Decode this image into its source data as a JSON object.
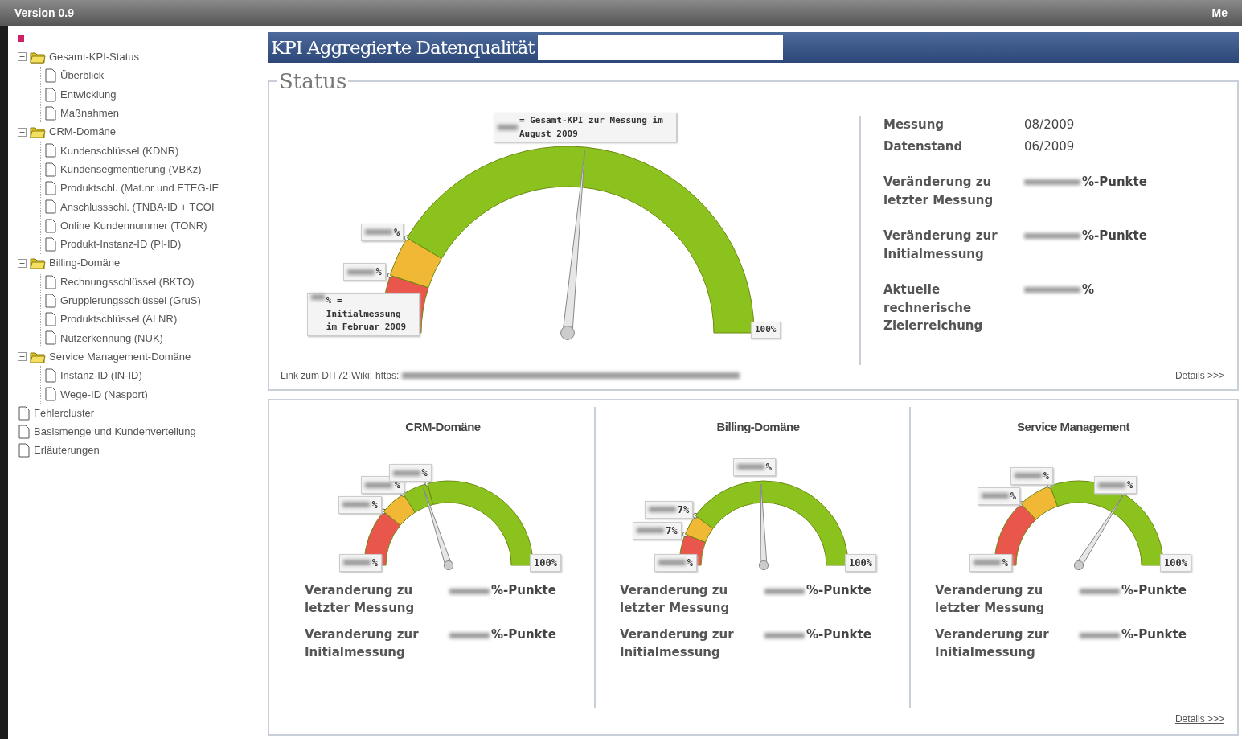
{
  "window": {
    "title": "Version 0.9",
    "title_right": "Me"
  },
  "sidebar": {
    "tree": [
      {
        "kind": "root"
      },
      {
        "kind": "folder",
        "label": "Gesamt-KPI-Status",
        "expanded": true,
        "children": [
          {
            "kind": "page",
            "label": "Überblick"
          },
          {
            "kind": "page",
            "label": "Entwicklung"
          },
          {
            "kind": "page",
            "label": "Maßnahmen"
          }
        ]
      },
      {
        "kind": "folder",
        "label": "CRM-Domäne",
        "expanded": true,
        "children": [
          {
            "kind": "page",
            "label": "Kundenschlüssel (KDNR)"
          },
          {
            "kind": "page",
            "label": "Kundensegmentierung (VBKz)"
          },
          {
            "kind": "page",
            "label": "Produktschl. (Mat.nr und ETEG-IE"
          },
          {
            "kind": "page",
            "label": "Anschlussschl. (TNBA-ID + TCOI"
          },
          {
            "kind": "page",
            "label": "Online Kundennummer (TONR)"
          },
          {
            "kind": "page",
            "label": "Produkt-Instanz-ID (PI-ID)"
          }
        ]
      },
      {
        "kind": "folder",
        "label": "Billing-Domäne",
        "expanded": true,
        "children": [
          {
            "kind": "page",
            "label": "Rechnungsschlüssel (BKTO)"
          },
          {
            "kind": "page",
            "label": "Gruppierungsschlüssel (GruS)"
          },
          {
            "kind": "page",
            "label": "Produktschlüssel (ALNR)"
          },
          {
            "kind": "page",
            "label": "Nutzerkennung (NUK)"
          }
        ]
      },
      {
        "kind": "folder",
        "label": "Service Management-Domäne",
        "expanded": true,
        "children": [
          {
            "kind": "page",
            "label": "Instanz-ID (IN-ID)"
          },
          {
            "kind": "page",
            "label": "Wege-ID (Nasport)"
          }
        ]
      },
      {
        "kind": "page",
        "label": "Fehlercluster"
      },
      {
        "kind": "page",
        "label": "Basismenge und Kundenverteilung"
      },
      {
        "kind": "page",
        "label": "Erläuterungen"
      }
    ]
  },
  "header": {
    "title": "KPI Aggregierte Datenqualität"
  },
  "status": {
    "legend": "Status",
    "gauge": {
      "start_label": "% = Initialmessung im Februar 2009",
      "end_label": "100%",
      "needle_label": "= Gesamt-KPI zur Messung im August 2009",
      "bands": [
        {
          "color": "#e8564c",
          "label": "%"
        },
        {
          "color": "#f0b835",
          "label": "%"
        },
        {
          "color": "#8cc21e"
        }
      ]
    },
    "info": [
      {
        "label": "Messung",
        "value": "08/2009",
        "redacted": false
      },
      {
        "label": "Datenstand",
        "value": "06/2009",
        "redacted": false
      },
      {
        "label": "Veränderung zu letzter Messung",
        "value": "%-Punkte",
        "redacted": true
      },
      {
        "label": "Veränderung zur Initialmessung",
        "value": "%-Punkte",
        "redacted": true
      },
      {
        "label": "Aktuelle rechnerische Zielerreichung",
        "value": "%",
        "redacted": true
      }
    ],
    "wiki_label": "Link zum DIT72-Wiki:",
    "wiki_link": "https:",
    "details": "Details >>>"
  },
  "domains": {
    "details": "Details >>>",
    "items": [
      {
        "title": "CRM-Domäne",
        "gauge": {
          "start_label": "%",
          "end_label": "100%",
          "bands": [
            {
              "color": "#e8564c",
              "label": "%"
            },
            {
              "color": "#f0b835",
              "label": "%"
            },
            {
              "color": "#8cc21e",
              "label": "%"
            },
            {
              "color": "#8cc21e"
            }
          ]
        },
        "stats": [
          {
            "label": "Veranderung zu letzter Messung",
            "value": "%-Punkte"
          },
          {
            "label": "Veranderung zur Initialmessung",
            "value": "%-Punkte"
          }
        ]
      },
      {
        "title": "Billing-Domäne",
        "gauge": {
          "start_label": "%",
          "end_label": "100%",
          "needle_label": "%",
          "bands": [
            {
              "color": "#e8564c",
              "label": "7%"
            },
            {
              "color": "#f0b835",
              "label": "7%"
            },
            {
              "color": "#8cc21e"
            }
          ]
        },
        "stats": [
          {
            "label": "Veranderung zu letzter Messung",
            "value": "%-Punkte"
          },
          {
            "label": "Veranderung zur Initialmessung",
            "value": "%-Punkte"
          }
        ]
      },
      {
        "title": "Service Management",
        "gauge": {
          "start_label": "%",
          "end_label": "100%",
          "bands": [
            {
              "color": "#e8564c",
              "label": "%"
            },
            {
              "color": "#f0b835",
              "label": "%"
            },
            {
              "color": "#8cc21e",
              "label": "%"
            },
            {
              "color": "#8cc21e"
            }
          ]
        },
        "stats": [
          {
            "label": "Veranderung zu letzter Messung",
            "value": "%-Punkte"
          },
          {
            "label": "Veranderung zur Initialmessung",
            "value": "%-Punkte"
          }
        ]
      }
    ]
  }
}
